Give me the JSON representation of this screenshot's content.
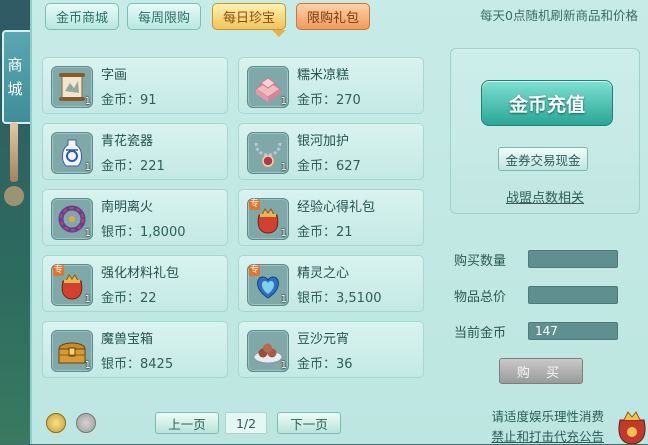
{
  "side_tab": {
    "label_1": "商",
    "label_2": "城"
  },
  "tabs": [
    {
      "label": "金币商城"
    },
    {
      "label": "每周限购"
    },
    {
      "label": "每日珍宝"
    },
    {
      "label": "限购礼包"
    }
  ],
  "notice": "每天0点随机刷新商品和价格",
  "items": [
    {
      "name": "字画",
      "price": "金币：91",
      "qty": "1",
      "icon": "scroll-painting-icon"
    },
    {
      "name": "糯米凉糕",
      "price": "金币：270",
      "qty": "1",
      "icon": "rice-cake-icon"
    },
    {
      "name": "青花瓷器",
      "price": "金币：221",
      "qty": "1",
      "icon": "porcelain-vase-icon"
    },
    {
      "name": "银河加护",
      "price": "金币：627",
      "qty": "1",
      "icon": "necklace-icon"
    },
    {
      "name": "南明离火",
      "price": "银币：1,8000",
      "qty": "1",
      "icon": "fire-ring-icon"
    },
    {
      "name": "经验心得礼包",
      "price": "金币：21",
      "qty": "1",
      "icon": "gift-bag-icon",
      "tag": "专"
    },
    {
      "name": "强化材料礼包",
      "price": "金币：22",
      "qty": "1",
      "icon": "gift-bag-icon",
      "tag": "专"
    },
    {
      "name": "精灵之心",
      "price": "银币：3,5100",
      "qty": "1",
      "icon": "spirit-heart-icon",
      "tag": "专"
    },
    {
      "name": "魔兽宝箱",
      "price": "银币：8425",
      "qty": "1",
      "icon": "treasure-chest-icon"
    },
    {
      "name": "豆沙元宵",
      "price": "金币：36",
      "qty": "1",
      "icon": "dumplings-icon"
    }
  ],
  "pager": {
    "prev": "上一页",
    "page": "1/2",
    "next": "下一页"
  },
  "right": {
    "recharge": "金币充值",
    "exchange": "金券交易现金",
    "alliance_link": "战盟点数相关"
  },
  "form": {
    "qty_label": "购买数量",
    "qty_value": "",
    "total_label": "物品总价",
    "total_value": "",
    "gold_label": "当前金币",
    "gold_value": "147",
    "buy": "购 买"
  },
  "footer": {
    "line1": "请适度娱乐理性消费",
    "line2": "禁止和打击代充公告"
  }
}
